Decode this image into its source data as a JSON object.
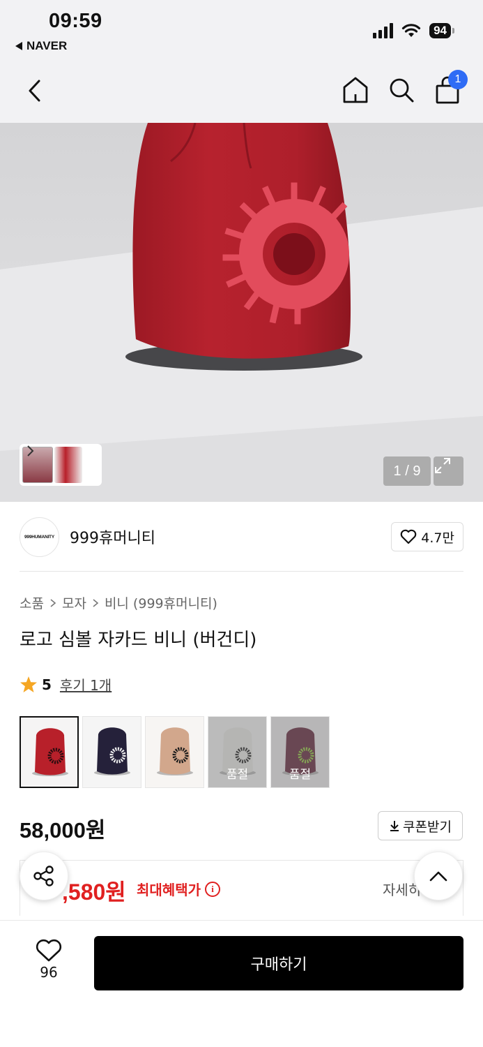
{
  "status_bar": {
    "time": "09:59",
    "back_app": "NAVER",
    "battery": "94",
    "icons": [
      "signal-icon",
      "wifi-icon",
      "battery-icon"
    ]
  },
  "nav": {
    "icons": [
      "back-chevron-icon",
      "home-icon",
      "search-icon",
      "shopping-bag-icon"
    ],
    "cart_count": "1"
  },
  "gallery": {
    "counter": "1 / 9",
    "icons": [
      "chevron-right-icon",
      "expand-icon"
    ]
  },
  "store": {
    "logo_text": "999HUMANITY",
    "name": "999휴머니티",
    "favorite_count": "4.7만"
  },
  "breadcrumb": [
    "소품",
    "모자",
    "비니 (999휴머니티)"
  ],
  "product": {
    "title": "로고 심볼 자카드 비니 (버건디)",
    "rating": "5",
    "reviews": "후기 1개",
    "price": "58,000원",
    "coupon_label": "쿠폰받기",
    "benefit_price": ",580원",
    "benefit_label": "최대혜택가",
    "detail_link": "자세히"
  },
  "options": [
    {
      "color": "#b8202a",
      "symbol": "#2a0d10",
      "bg": "#f5f4f4",
      "sold_out": ""
    },
    {
      "color": "#25213a",
      "symbol": "#f0f0f0",
      "bg": "#f5f5f5",
      "sold_out": ""
    },
    {
      "color": "#d2a78c",
      "symbol": "#1a1a1a",
      "bg": "#f7f5f3",
      "sold_out": ""
    },
    {
      "color": "#e8e8e4",
      "symbol": "#1a1a1a",
      "bg": "#f2f2f2",
      "sold_out": "품절"
    },
    {
      "color": "#5e1f35",
      "symbol": "#8fc93a",
      "bg": "#eceaeb",
      "sold_out": "품절"
    }
  ],
  "bottom": {
    "like_count": "96",
    "buy_label": "구매하기"
  },
  "colors": {
    "accent_red": "#e02020",
    "badge_blue": "#2f6cf5",
    "beanie_red": "#b51f2c",
    "symbol_pink": "#e54a5e"
  }
}
